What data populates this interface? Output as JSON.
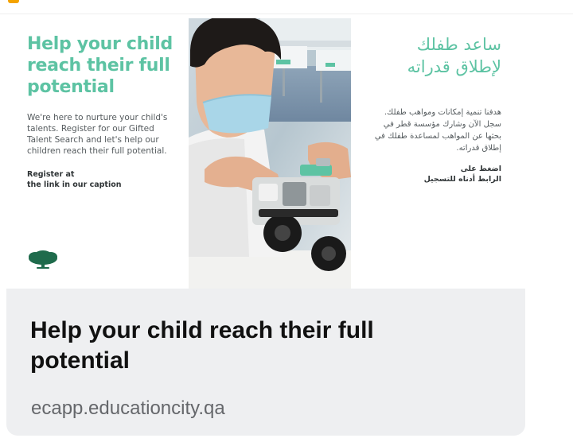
{
  "colors": {
    "brand_green": "#5dc3a3",
    "logo_green": "#1f6b4c",
    "card_background": "#eeeff1",
    "title_text": "#111111",
    "domain_text": "#65676b"
  },
  "ad": {
    "english": {
      "headline": "Help your child reach their full potential",
      "body": "We're here to nurture your child's talents. Register for our Gifted Talent Search and let's help our children reach their full potential.",
      "register_line1": "Register at",
      "register_line2": "the link in our caption"
    },
    "arabic": {
      "headline_line1": "ساعد طفلك",
      "headline_line2": "لإطلاق قدراته",
      "body": "هدفنا تنمية إمكانات ومواهب طفلك. سجل الآن وشارك مؤسسة قطر في بحثها عن المواهب لمساعدة طفلك في إطلاق قدراته.",
      "register_line1": "اضغط على",
      "register_line2": "الرابط أدناه للتسجيل"
    },
    "logo_icon": "tree-logo-icon",
    "photo_subject": "child-building-robot-photo"
  },
  "link_preview": {
    "title": "Help your child reach their full potential",
    "domain": "ecapp.educationcity.qa"
  }
}
